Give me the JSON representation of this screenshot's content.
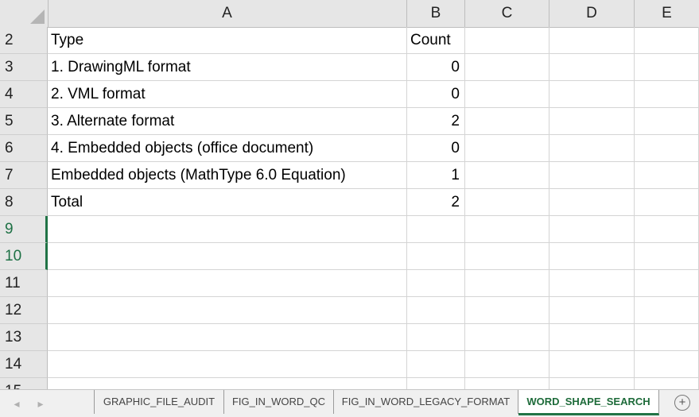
{
  "columns": [
    "A",
    "B",
    "C",
    "D",
    "E"
  ],
  "rows": [
    {
      "num": "2",
      "a": "Type",
      "b": "Count",
      "b_align": "left"
    },
    {
      "num": "3",
      "a": "1. DrawingML format",
      "b": "0"
    },
    {
      "num": "4",
      "a": "2. VML format",
      "b": "0"
    },
    {
      "num": "5",
      "a": "3. Alternate format",
      "b": "2"
    },
    {
      "num": "6",
      "a": "4. Embedded objects (office document)",
      "b": "0"
    },
    {
      "num": "7",
      "a": "Embedded objects (MathType 6.0 Equation)",
      "b": "1"
    },
    {
      "num": "8",
      "a": "Total",
      "b": "2"
    },
    {
      "num": "9",
      "a": "",
      "b": "",
      "selected": true
    },
    {
      "num": "10",
      "a": "",
      "b": "",
      "selected": true
    },
    {
      "num": "11",
      "a": "",
      "b": ""
    },
    {
      "num": "12",
      "a": "",
      "b": ""
    },
    {
      "num": "13",
      "a": "",
      "b": ""
    },
    {
      "num": "14",
      "a": "",
      "b": ""
    },
    {
      "num": "15",
      "a": "",
      "b": ""
    }
  ],
  "sheet_tabs": [
    {
      "label": "GRAPHIC_FILE_AUDIT",
      "active": false
    },
    {
      "label": "FIG_IN_WORD_QC",
      "active": false
    },
    {
      "label": "FIG_IN_WORD_LEGACY_FORMAT",
      "active": false
    },
    {
      "label": "WORD_SHAPE_SEARCH",
      "active": true
    }
  ],
  "nav": {
    "prev_icon": "chevron-left-icon",
    "next_icon": "chevron-right-icon",
    "prev_glyph": "◂",
    "next_glyph": "▸"
  },
  "add_sheet": {
    "icon": "plus-circle-icon",
    "glyph": "+"
  },
  "colors": {
    "accent": "#217346",
    "header_bg": "#e6e6e6",
    "gridline": "#d4d4d4"
  }
}
